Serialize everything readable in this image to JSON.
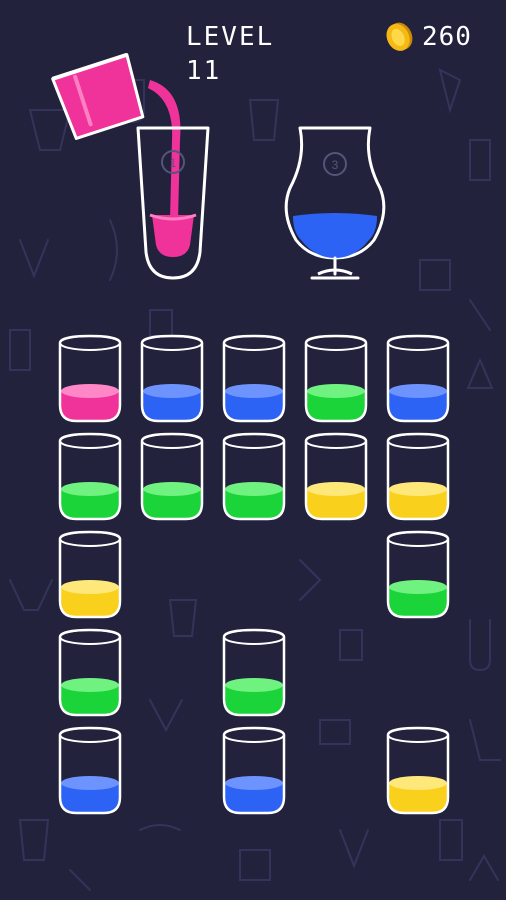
{
  "hud": {
    "level_label": "LEVEL 11",
    "coin_icon": "coin-icon",
    "coins": "260"
  },
  "colors": {
    "background": "#22223d",
    "glass_outline": "#ffffff",
    "pink": "#f0339a",
    "blue": "#2d63f5",
    "green": "#1ad43a",
    "yellow": "#f9d11c",
    "coin": "#f5b915"
  },
  "orders": [
    {
      "glass": "pint-glass",
      "badge": "1",
      "fill_color": "pink",
      "being_filled": true
    },
    {
      "glass": "goblet-glass",
      "badge": "3",
      "fill_color": "blue",
      "being_filled": false
    }
  ],
  "pouring_cup": {
    "color": "pink"
  },
  "cups": [
    {
      "row": 1,
      "col": 1,
      "color": "pink"
    },
    {
      "row": 1,
      "col": 2,
      "color": "blue"
    },
    {
      "row": 1,
      "col": 3,
      "color": "blue"
    },
    {
      "row": 1,
      "col": 4,
      "color": "green"
    },
    {
      "row": 1,
      "col": 5,
      "color": "blue"
    },
    {
      "row": 2,
      "col": 1,
      "color": "green"
    },
    {
      "row": 2,
      "col": 2,
      "color": "green"
    },
    {
      "row": 2,
      "col": 3,
      "color": "green"
    },
    {
      "row": 2,
      "col": 4,
      "color": "yellow"
    },
    {
      "row": 2,
      "col": 5,
      "color": "yellow"
    },
    {
      "row": 3,
      "col": 1,
      "color": "yellow"
    },
    {
      "row": 3,
      "col": 5,
      "color": "green"
    },
    {
      "row": 4,
      "col": 1,
      "color": "green"
    },
    {
      "row": 4,
      "col": 3,
      "color": "green"
    },
    {
      "row": 5,
      "col": 1,
      "color": "blue"
    },
    {
      "row": 5,
      "col": 3,
      "color": "blue"
    },
    {
      "row": 5,
      "col": 5,
      "color": "yellow"
    }
  ]
}
